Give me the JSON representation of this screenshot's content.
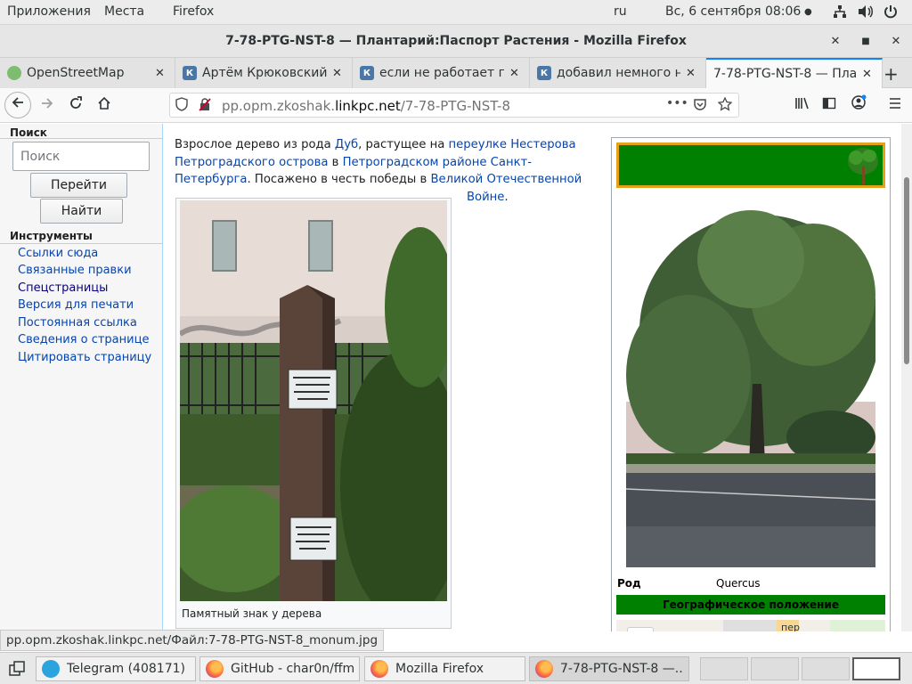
{
  "topbar": {
    "applications": "Приложения",
    "places": "Места",
    "app_name": "Firefox",
    "keyboard_layout": "ru",
    "datetime": "Вс, 6 сентября  08:06"
  },
  "window": {
    "title": "7-78-PTG-NST-8 — Плантарий:Паспорт Растения - Mozilla Firefox"
  },
  "tabs": [
    {
      "label": "OpenStreetMap",
      "favicon": "osm-icon"
    },
    {
      "label": "Артём Крюковский",
      "favicon": "vk-icon"
    },
    {
      "label": "если не работает пла",
      "favicon": "vk-icon"
    },
    {
      "label": "добавил немного ня",
      "favicon": "vk-icon"
    },
    {
      "label": "7-78-PTG-NST-8 — Пла",
      "favicon": "none",
      "active": true
    }
  ],
  "urlbar": {
    "prefix": "pp.opm.zkoshak.",
    "domain": "linkpc.net",
    "path": "/7-78-PTG-NST-8"
  },
  "sidebar": {
    "search_heading": "Поиск",
    "search_placeholder": "Поиск",
    "go_button": "Перейти",
    "find_button": "Найти",
    "tools_heading": "Инструменты",
    "tools": [
      "Ссылки сюда",
      "Связанные правки",
      "Спецстраницы",
      "Версия для печати",
      "Постоянная ссылка",
      "Сведения о странице",
      "Цитировать страницу"
    ]
  },
  "article": {
    "t1": "Взрослое дерево из рода ",
    "link_genus": "Дуб",
    "t2": ", растущее на ",
    "link_street": "переулке Нестерова Петроградского острова",
    "t3": " в ",
    "link_district": "Петроградском районе Санкт-Петербурга",
    "t4": ". Посажено в честь победы в ",
    "link_war_1": "Великой Отечественной",
    "link_war_2": "Войне",
    "t5": ".",
    "thumb_caption": "Памятный знак у дерева"
  },
  "infobox": {
    "row_label": "Род",
    "row_value": "Quercus",
    "geo_heading": "Географическое положение",
    "map_zoom_in": "+",
    "map_street_fragment": "пер"
  },
  "status_url": "pp.opm.zkoshak.linkpc.net/Файл:7-78-PTG-NST-8_monum.jpg",
  "taskbar": [
    {
      "label": "Telegram (408171)",
      "icon": "telegram-icon"
    },
    {
      "label": "GitHub - char0n/ffm...",
      "icon": "firefox-icon"
    },
    {
      "label": "Mozilla Firefox",
      "icon": "firefox-icon"
    },
    {
      "label": "7-78-PTG-NST-8 —...",
      "icon": "firefox-icon",
      "active": true
    }
  ],
  "colors": {
    "link": "#0645ad",
    "infobox_green": "#008000",
    "infobox_border": "#e6a11b",
    "tab_accent": "#0a84ff"
  }
}
